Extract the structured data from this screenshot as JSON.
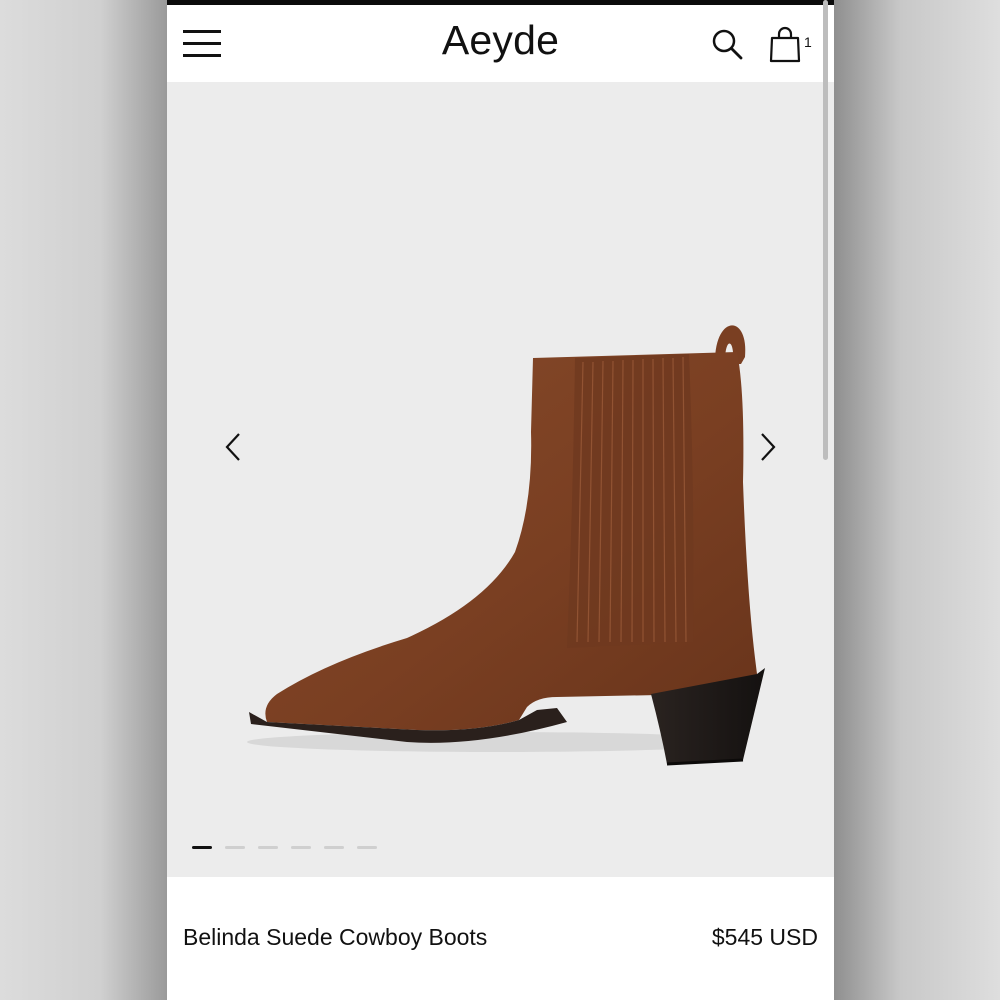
{
  "header": {
    "brand": "Aeyde",
    "cart_count": "1",
    "icons": [
      "hamburger-menu-icon",
      "search-icon",
      "shopping-bag-icon"
    ]
  },
  "gallery": {
    "slide_count": 6,
    "active_slide": 1,
    "icons": [
      "chevron-left-icon",
      "chevron-right-icon"
    ]
  },
  "product": {
    "name": "Belinda Suede Cowboy Boots",
    "price": "$545 USD",
    "colors": {
      "suede": "#7a3f22",
      "heel": "#1f1a17"
    }
  }
}
